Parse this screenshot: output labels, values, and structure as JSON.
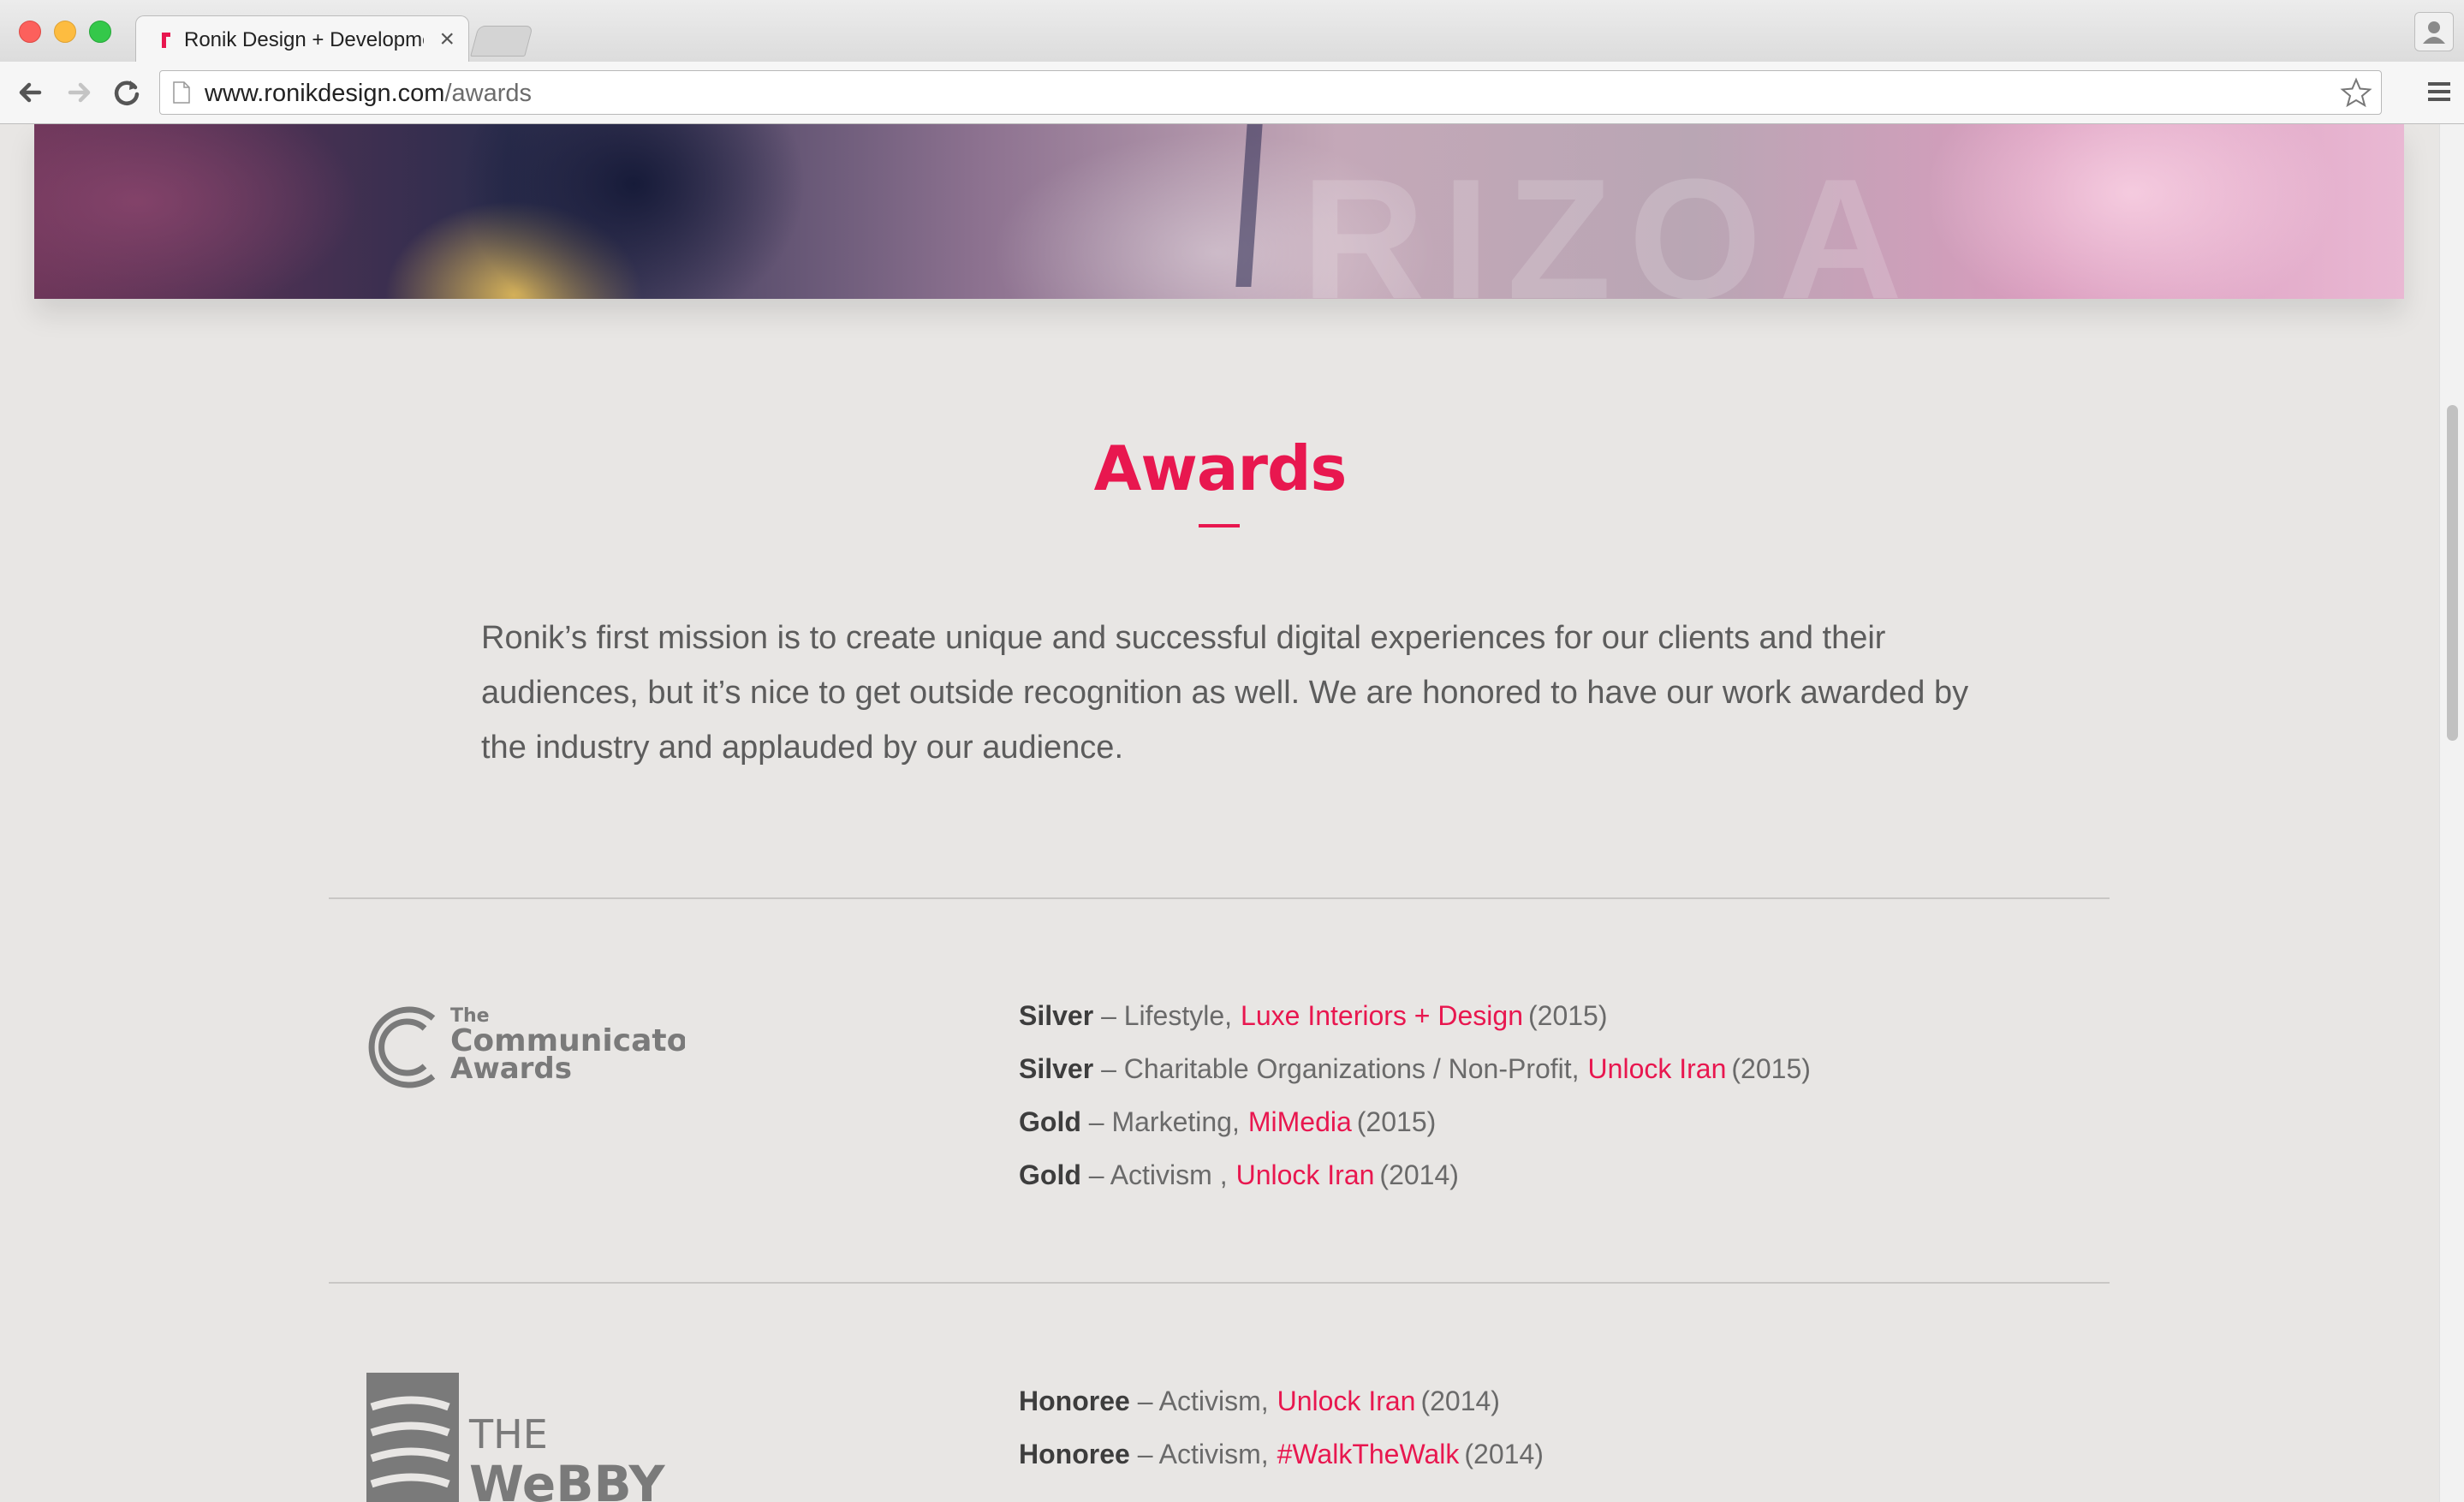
{
  "browser": {
    "tab_title": "Ronik Design + Development",
    "tab_close": "×",
    "url_domain": "www.ronikdesign.com",
    "url_path": "/awards"
  },
  "page": {
    "title": "Awards",
    "intro": "Ronik’s first mission is to create unique and successful digital experiences for our clients and their audiences, but it’s nice to get outside recognition as well. We are honored to have our work awarded by the industry and applauded by our audience."
  },
  "logos": {
    "communicator": {
      "line1": "The",
      "line2": "Communicator",
      "line3": "Awards"
    },
    "webby": {
      "line1": "THE",
      "line2": "WeBBY"
    }
  },
  "award_groups": [
    {
      "awards": [
        {
          "level": "Silver",
          "category": " – Lifestyle,",
          "project": "Luxe Interiors + Design",
          "year": "(2015)"
        },
        {
          "level": "Silver",
          "category": " – Charitable Organizations / Non-Profit,",
          "project": "Unlock Iran",
          "year": "(2015)"
        },
        {
          "level": "Gold",
          "category": " – Marketing,",
          "project": "MiMedia",
          "year": "(2015)"
        },
        {
          "level": "Gold",
          "category": " – Activism ,",
          "project": "Unlock Iran",
          "year": "(2014)"
        }
      ]
    },
    {
      "awards": [
        {
          "level": "Honoree",
          "category": " – Activism,",
          "project": "Unlock Iran",
          "year": "(2014)"
        },
        {
          "level": "Honoree",
          "category": " – Activism,",
          "project": "#WalkTheWalk",
          "year": "(2014)"
        }
      ]
    }
  ],
  "colors": {
    "accent": "#e8174f",
    "background": "#e8e6e4",
    "text": "#5c5c5c"
  }
}
